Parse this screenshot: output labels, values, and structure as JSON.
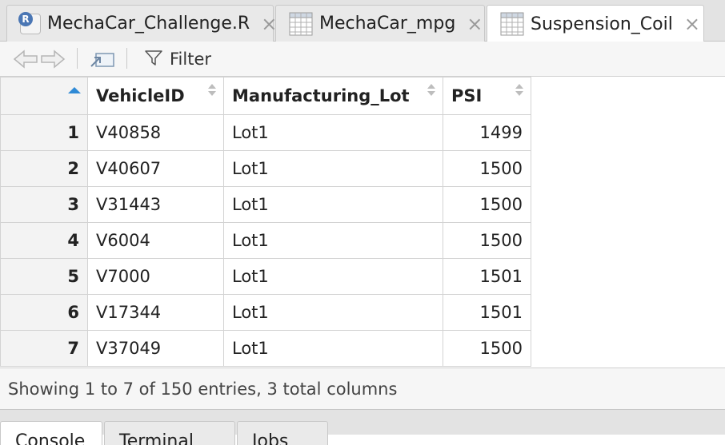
{
  "tabs": [
    {
      "label": "MechaCar_Challenge.R",
      "icon": "r-script-icon",
      "icon_letter": "R",
      "active": false
    },
    {
      "label": "MechaCar_mpg",
      "icon": "data-grid-icon",
      "active": false
    },
    {
      "label": "Suspension_Coil",
      "icon": "data-grid-icon",
      "active": true
    }
  ],
  "tab_close_glyph": "×",
  "toolbar": {
    "filter_label": "Filter"
  },
  "table": {
    "columns": [
      "VehicleID",
      "Manufacturing_Lot",
      "PSI"
    ],
    "rows": [
      {
        "n": "1",
        "VehicleID": "V40858",
        "Manufacturing_Lot": "Lot1",
        "PSI": "1499"
      },
      {
        "n": "2",
        "VehicleID": "V40607",
        "Manufacturing_Lot": "Lot1",
        "PSI": "1500"
      },
      {
        "n": "3",
        "VehicleID": "V31443",
        "Manufacturing_Lot": "Lot1",
        "PSI": "1500"
      },
      {
        "n": "4",
        "VehicleID": "V6004",
        "Manufacturing_Lot": "Lot1",
        "PSI": "1500"
      },
      {
        "n": "5",
        "VehicleID": "V7000",
        "Manufacturing_Lot": "Lot1",
        "PSI": "1501"
      },
      {
        "n": "6",
        "VehicleID": "V17344",
        "Manufacturing_Lot": "Lot1",
        "PSI": "1501"
      },
      {
        "n": "7",
        "VehicleID": "V37049",
        "Manufacturing_Lot": "Lot1",
        "PSI": "1500"
      }
    ]
  },
  "status": {
    "text": "Showing 1 to 7 of 150 entries, 3 total columns"
  },
  "bottom_tabs": [
    {
      "label": "Console",
      "active": true
    },
    {
      "label": "Terminal",
      "active": false
    },
    {
      "label": "Jobs",
      "active": false
    }
  ],
  "colors": {
    "sort_active": "#2f8ad6",
    "r_badge": "#4a76b4"
  }
}
